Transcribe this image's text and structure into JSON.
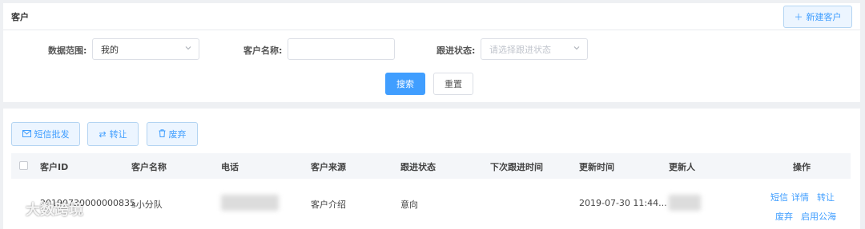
{
  "header": {
    "title": "客户",
    "new_button_label": "新建客户"
  },
  "filters": {
    "scope_label": "数据范围:",
    "scope_value": "我的",
    "name_label": "客户名称:",
    "name_value": "",
    "status_label": "跟进状态:",
    "status_placeholder": "请选择跟进状态",
    "search_label": "搜索",
    "reset_label": "重置"
  },
  "actions": {
    "sms_label": "短信批发",
    "transfer_label": "转让",
    "discard_label": "废弃"
  },
  "table": {
    "columns": [
      "客户ID",
      "客户名称",
      "电话",
      "客户来源",
      "跟进状态",
      "下次跟进时间",
      "更新时间",
      "更新人",
      "操作"
    ],
    "rows": [
      {
        "id": "20190730000000835",
        "name": "s小分队",
        "phone": "",
        "source": "客户介绍",
        "status": "意向",
        "next_follow_up": "",
        "updated_at": "2019-07-30 11:44...",
        "updated_by": "",
        "ops": [
          "短信",
          "详情",
          "转让",
          "废弃",
          "启用公海"
        ]
      }
    ]
  },
  "watermark": {
    "text": "大数跨境"
  },
  "colors": {
    "primary": "#409eff",
    "primary_light_bg": "#ecf5ff",
    "border": "#dcdfe6"
  },
  "icons": {
    "new": "plus-icon",
    "sms": "envelope-icon",
    "transfer": "swap-icon",
    "discard": "trash-icon",
    "select": "chevron-down-icon"
  }
}
